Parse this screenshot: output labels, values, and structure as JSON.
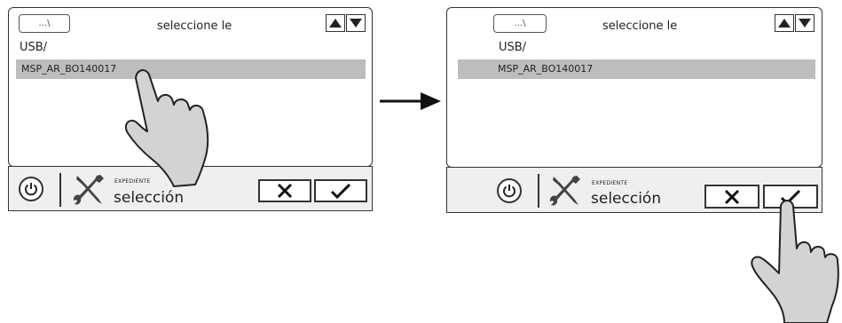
{
  "screens": [
    {
      "back_button_label": "...\\",
      "title": "seleccione le",
      "path": "USB/",
      "file_item": "MSP_AR_BO140017",
      "small_label": "EXPEDIENTE",
      "big_label": "selección"
    },
    {
      "back_button_label": "...\\",
      "title": "seleccione le",
      "path": "USB/",
      "file_item": "MSP_AR_BO140017",
      "small_label": "EXPEDIENTE",
      "big_label": "selección"
    }
  ],
  "icons": {
    "up": "triangle-up-icon",
    "down": "triangle-down-icon",
    "power": "power-icon",
    "tools": "wrench-screwdriver-icon",
    "cancel": "x-icon",
    "confirm": "check-icon",
    "flow": "right-arrow-icon",
    "hand": "pointing-hand-icon"
  }
}
